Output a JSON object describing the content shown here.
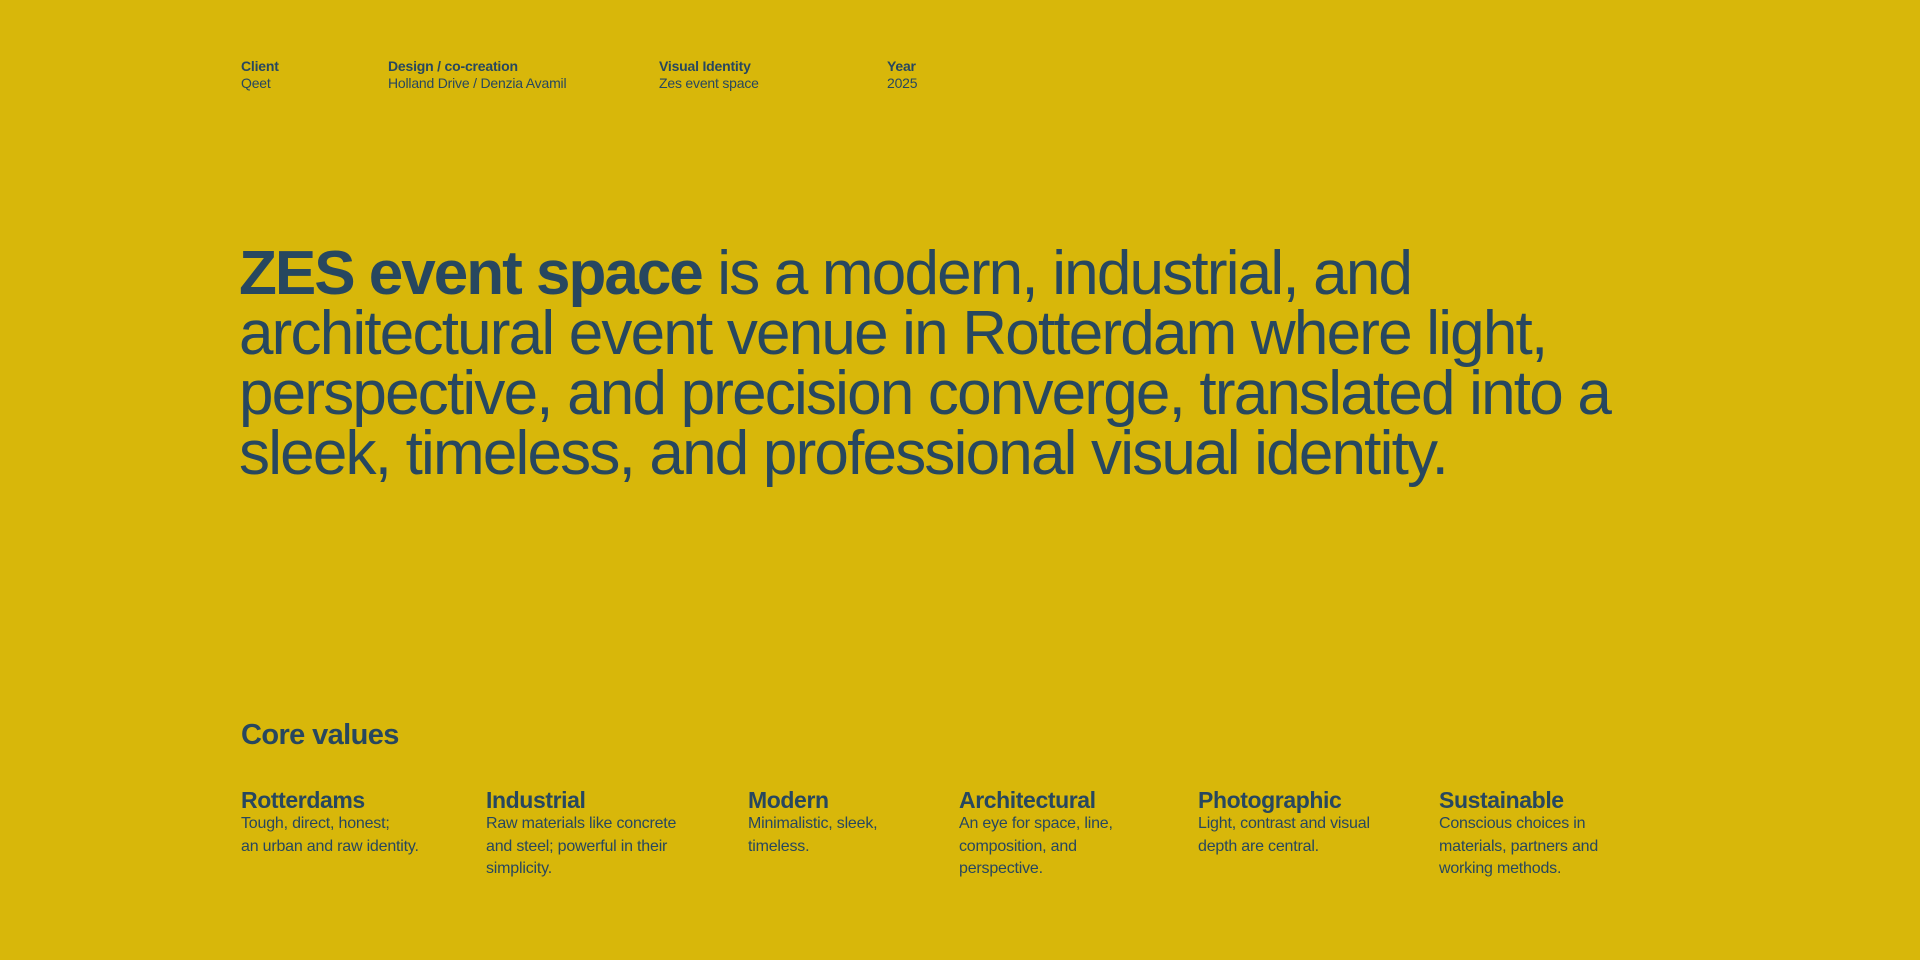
{
  "meta": {
    "client_label": "Client",
    "client_value": "Qeet",
    "design_label": "Design / co-creation",
    "design_value": "Holland Drive / Denzia Avamil",
    "identity_label": "Visual Identity",
    "identity_value": "Zes event space",
    "year_label": "Year",
    "year_value": "2025"
  },
  "intro": {
    "strong": "ZES event space",
    "rest": " is a modern, industrial, and architectural event venue in Rotterdam where light, perspective, and precision converge, translated into a sleek, timeless, and professional visual identity."
  },
  "core": {
    "title": "Core values",
    "values": [
      {
        "title": "Rotterdams",
        "desc_line1": "Tough, direct, honest;",
        "desc_line2": "an urban and raw identity."
      },
      {
        "title": "Industrial",
        "desc": "Raw materials like concrete and steel; powerful in their simplicity."
      },
      {
        "title": "Modern",
        "desc": "Minimalistic, sleek, timeless."
      },
      {
        "title": "Architectural",
        "desc": "An eye for space, line, composition, and perspective."
      },
      {
        "title": "Photographic",
        "desc": "Light, contrast and visual depth are central."
      },
      {
        "title": "Sustainable",
        "desc": "Conscious choices in materials, partners and working methods."
      }
    ]
  },
  "colors": {
    "background": "#D8B70A",
    "text": "#27475F"
  }
}
